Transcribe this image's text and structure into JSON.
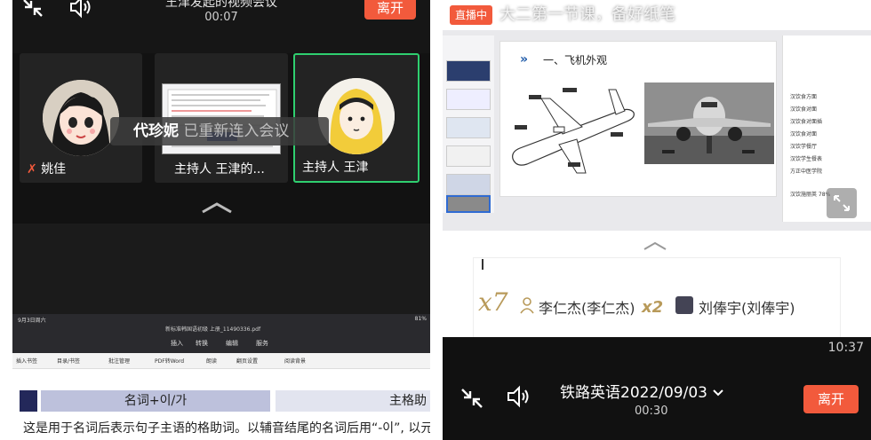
{
  "left": {
    "meeting_title": "王津发起的视频会议",
    "meeting_time": "00:07",
    "leave_label": "离开",
    "participants": [
      {
        "label": "姚佳"
      },
      {
        "label": "主持人 王津的..."
      },
      {
        "label": "主持人 王津"
      }
    ],
    "notice": {
      "name": "代珍妮",
      "message": " 已重新连入会议"
    },
    "pdf": {
      "status": "9月3日周六",
      "filename": "新标准韩国语初级 上册_11490336.pdf",
      "status_right": "81%",
      "menu": [
        "插入",
        "转换",
        "编辑",
        "服务"
      ],
      "tools": [
        "插入书签",
        "目录/书签",
        "批注管理",
        "PDF转Word",
        "朗读",
        "翻页设置",
        "阅读背景"
      ],
      "head_left": "名词+이/가",
      "head_right": "主格助",
      "body": "这是用于名词后表示句子主语的格助词。以辅音结尾的名词后用“-이”, 以元音"
    }
  },
  "right": {
    "live_badge": "直播中",
    "live_title": "大二第一节课，备好纸笔",
    "slide_heading": "一、飞机外观",
    "side_lines": [
      "汉饮食方面",
      "汉饮食对面",
      "汉饮食对面插",
      "汉饮食对面",
      "汉饮学餐厅",
      "汉饮学生餐表",
      "方正中医学院",
      "汉饮施丽英 78%"
    ],
    "chat": {
      "multiplier1": "x7",
      "user1": "李仁杰(李仁杰)",
      "multiplier2": "x2",
      "user2": "刘俸宇(刘俸宇)"
    },
    "status_time": "10:37",
    "title": "铁路英语2022/09/03",
    "time": "00:30",
    "leave_label": "离开"
  },
  "colors": {
    "accent": "#f25a3c",
    "active_border": "#2fcf6f"
  }
}
